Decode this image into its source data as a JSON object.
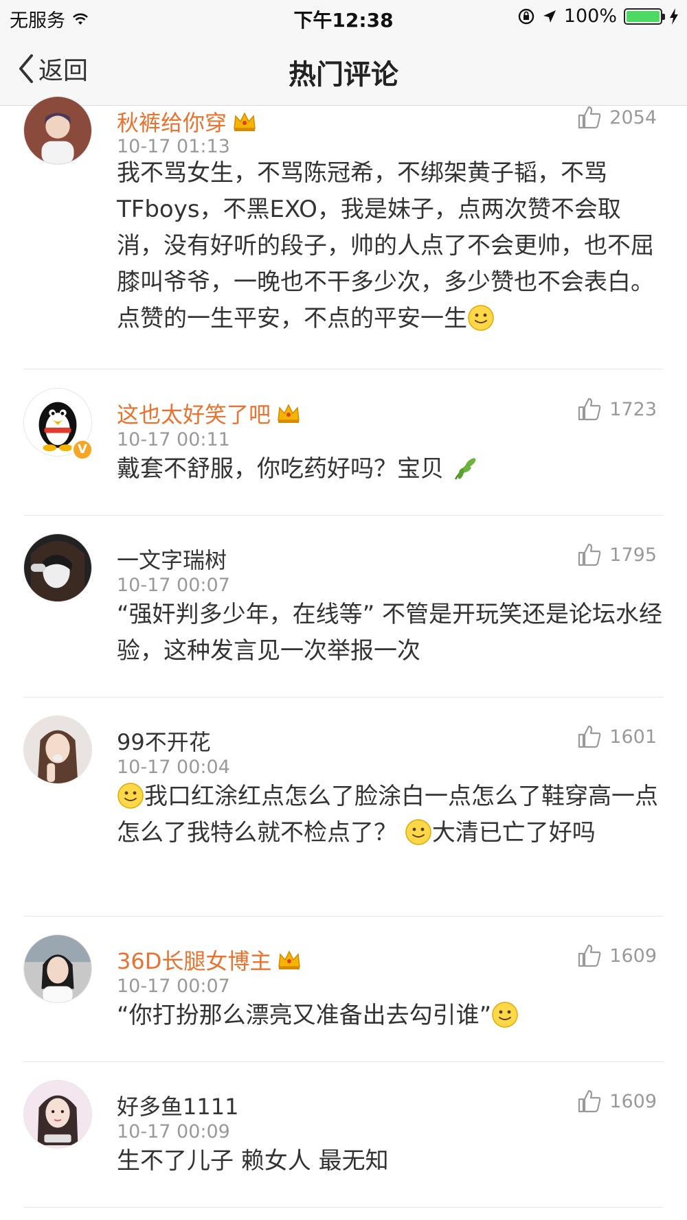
{
  "status_bar": {
    "carrier": "无服务",
    "time": "下午12:38",
    "battery": "100%",
    "battery_level": 1.0
  },
  "nav": {
    "back_label": "返回",
    "title": "热门评论"
  },
  "colors": {
    "vip_name": "#e8722e",
    "timestamp": "#999999",
    "battery_fill": "#4cd964",
    "badge": "#f5a623"
  },
  "comments": [
    {
      "username": "秋裤给你穿",
      "vip": true,
      "time": "10-17 01:13",
      "likes": "2054",
      "text_parts": [
        "我不骂女生，不骂陈冠希，不绑架黄子韬，不骂TFboys，不黑EXO，我是妹子，点两次赞不会取消，没有好听的段子，帅的人点了不会更帅，也不屈膝叫爷爷，一晚也不干多少次，多少赞也不会表白。点赞的一生平安，不点的平安一生"
      ],
      "emoji": [
        "smiley-icon"
      ]
    },
    {
      "username": "这也太好笑了吧",
      "vip": true,
      "verified": true,
      "time": "10-17 00:11",
      "likes": "1723",
      "text_parts": [
        "戴套不舒服，你吃药好吗？宝贝 "
      ],
      "emoji": [
        "leaf-icon"
      ]
    },
    {
      "username": "一文字瑞树",
      "vip": false,
      "time": "10-17 00:07",
      "likes": "1795",
      "text_parts": [
        "“强奸判多少年，在线等” 不管是开玩笑还是论坛水经验，这种发言见一次举报一次"
      ]
    },
    {
      "username": "99不开花",
      "vip": false,
      "time": "10-17 00:04",
      "likes": "1601",
      "text_parts": [
        "我口红涂红点怎么了脸涂白一点怎么了鞋穿高一点怎么了我特么就不检点了？",
        "大清已亡了好吗"
      ],
      "emoji": [
        "smiley-icon",
        "smiley-icon"
      ]
    },
    {
      "username": "36D长腿女博主",
      "vip": true,
      "time": "10-17 00:07",
      "likes": "1609",
      "text_parts": [
        "“你打扮那么漂亮又准备出去勾引谁”"
      ],
      "emoji": [
        "smiley-icon"
      ]
    },
    {
      "username": "好多鱼1111",
      "vip": false,
      "time": "10-17 00:09",
      "likes": "1609",
      "text_parts": [
        "生不了儿子 赖女人 最无知"
      ]
    }
  ]
}
